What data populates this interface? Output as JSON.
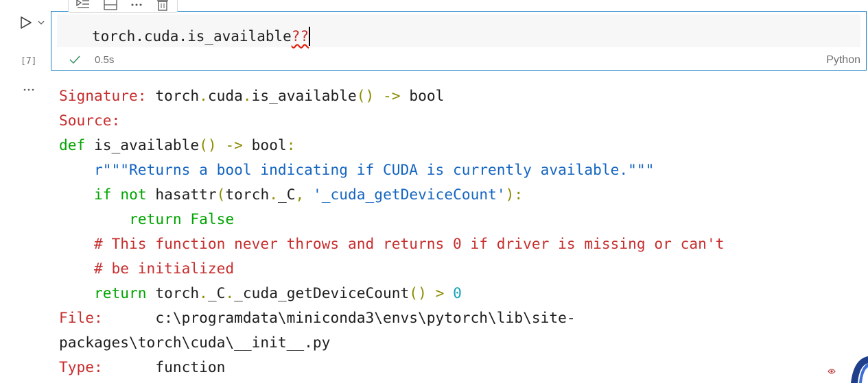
{
  "toolbar": {
    "icons": [
      "run-by-line-icon",
      "split-cell-icon",
      "more-icon",
      "delete-icon"
    ]
  },
  "cell": {
    "execution_count": "[7]",
    "code_text": "torch.cuda.is_available",
    "code_suffix": "??",
    "duration": "0.5s",
    "language": "Python",
    "status_icon": "check-icon",
    "status_color": "#2e8b57",
    "border_color": "#1b7fc8"
  },
  "output": {
    "signature_label": "Signature:",
    "signature_value": "torch.cuda.is_available() -> bool",
    "source_label": "Source:",
    "source_lines": [
      "def is_available() -> bool:",
      "    r\"\"\"Returns a bool indicating if CUDA is currently available.\"\"\"",
      "    if not hasattr(torch._C, '_cuda_getDeviceCount'):",
      "        return False",
      "    # This function never throws and returns 0 if driver is missing or can't",
      "    # be initialized",
      "    return torch._C._cuda_getDeviceCount() > 0"
    ],
    "file_label": "File:",
    "file_value_line1": "c:\\programdata\\miniconda3\\envs\\pytorch\\lib\\site-",
    "file_value_line2": "packages\\torch\\cuda\\__init__.py",
    "type_label": "Type:",
    "type_value": "function"
  },
  "colors": {
    "label": "#c72e2e",
    "keyword": "#00a400",
    "operator": "#8c8c00",
    "string": "#1565c0",
    "number": "#14a3b8"
  }
}
